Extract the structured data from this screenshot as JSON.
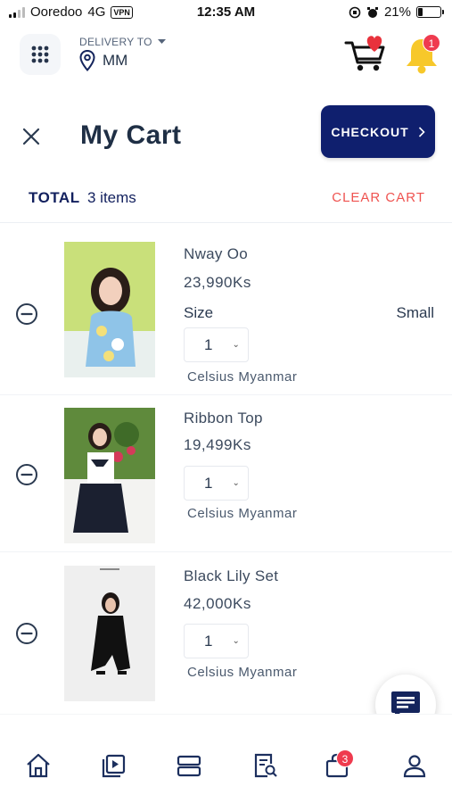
{
  "status_bar": {
    "carrier": "Ooredoo",
    "network": "4G",
    "vpn": "VPN",
    "time": "12:35 AM",
    "battery": "21%",
    "battery_level": 0.21
  },
  "header": {
    "delivery_label": "DELIVERY TO",
    "delivery_value": "MM",
    "notification_count": "1"
  },
  "cart": {
    "title": "My Cart",
    "checkout_label": "CHECKOUT",
    "total_label": "TOTAL",
    "total_count": "3 items",
    "clear_label": "CLEAR CART",
    "items": [
      {
        "name": "Nway Oo",
        "price": "23,990Ks",
        "size_label": "Size",
        "size_value": "Small",
        "quantity": "1",
        "store": "Celsius Myanmar"
      },
      {
        "name": "Ribbon Top",
        "price": "19,499Ks",
        "quantity": "1",
        "store": "Celsius Myanmar"
      },
      {
        "name": "Black Lily Set",
        "price": "42,000Ks",
        "quantity": "1",
        "store": "Celsius Myanmar"
      }
    ]
  },
  "bottom_nav": {
    "items": [
      "home-icon",
      "video-icon",
      "categories-icon",
      "search-orders-icon",
      "bag-icon",
      "profile-icon"
    ],
    "bag_badge": "3"
  },
  "colors": {
    "primary": "#0f1f6e",
    "text": "#1f2f45",
    "danger": "#ef5350",
    "badge": "#ef3b4f",
    "bell": "#f7c82a"
  }
}
